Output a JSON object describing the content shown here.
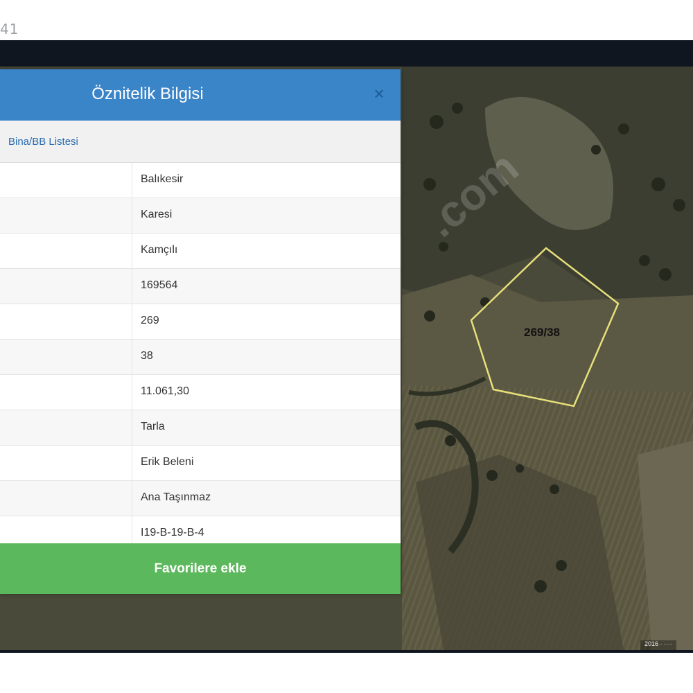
{
  "status": {
    "time_fragment": "41"
  },
  "dialog": {
    "title": "Öznitelik Bilgisi",
    "close_symbol": "×",
    "tab_link": "Bina/BB Listesi",
    "rows": [
      {
        "value": "Balıkesir"
      },
      {
        "value": "Karesi"
      },
      {
        "value": "Kamçılı"
      },
      {
        "value": "169564"
      },
      {
        "value": "269"
      },
      {
        "value": "38"
      },
      {
        "value": "11.061,30"
      },
      {
        "value": "Tarla"
      },
      {
        "value": "Erik Beleni"
      },
      {
        "value": "Ana Taşınmaz"
      },
      {
        "value": "I19-B-19-B-4"
      }
    ],
    "favorite_button": "Favorilere ekle"
  },
  "map": {
    "parcel_label": "269/38",
    "watermark": ".com",
    "attribution": "2016 · ····",
    "colors": {
      "parcel_outline": "#e8e07a",
      "header": "#3a84c8",
      "button": "#5cb85c"
    }
  }
}
